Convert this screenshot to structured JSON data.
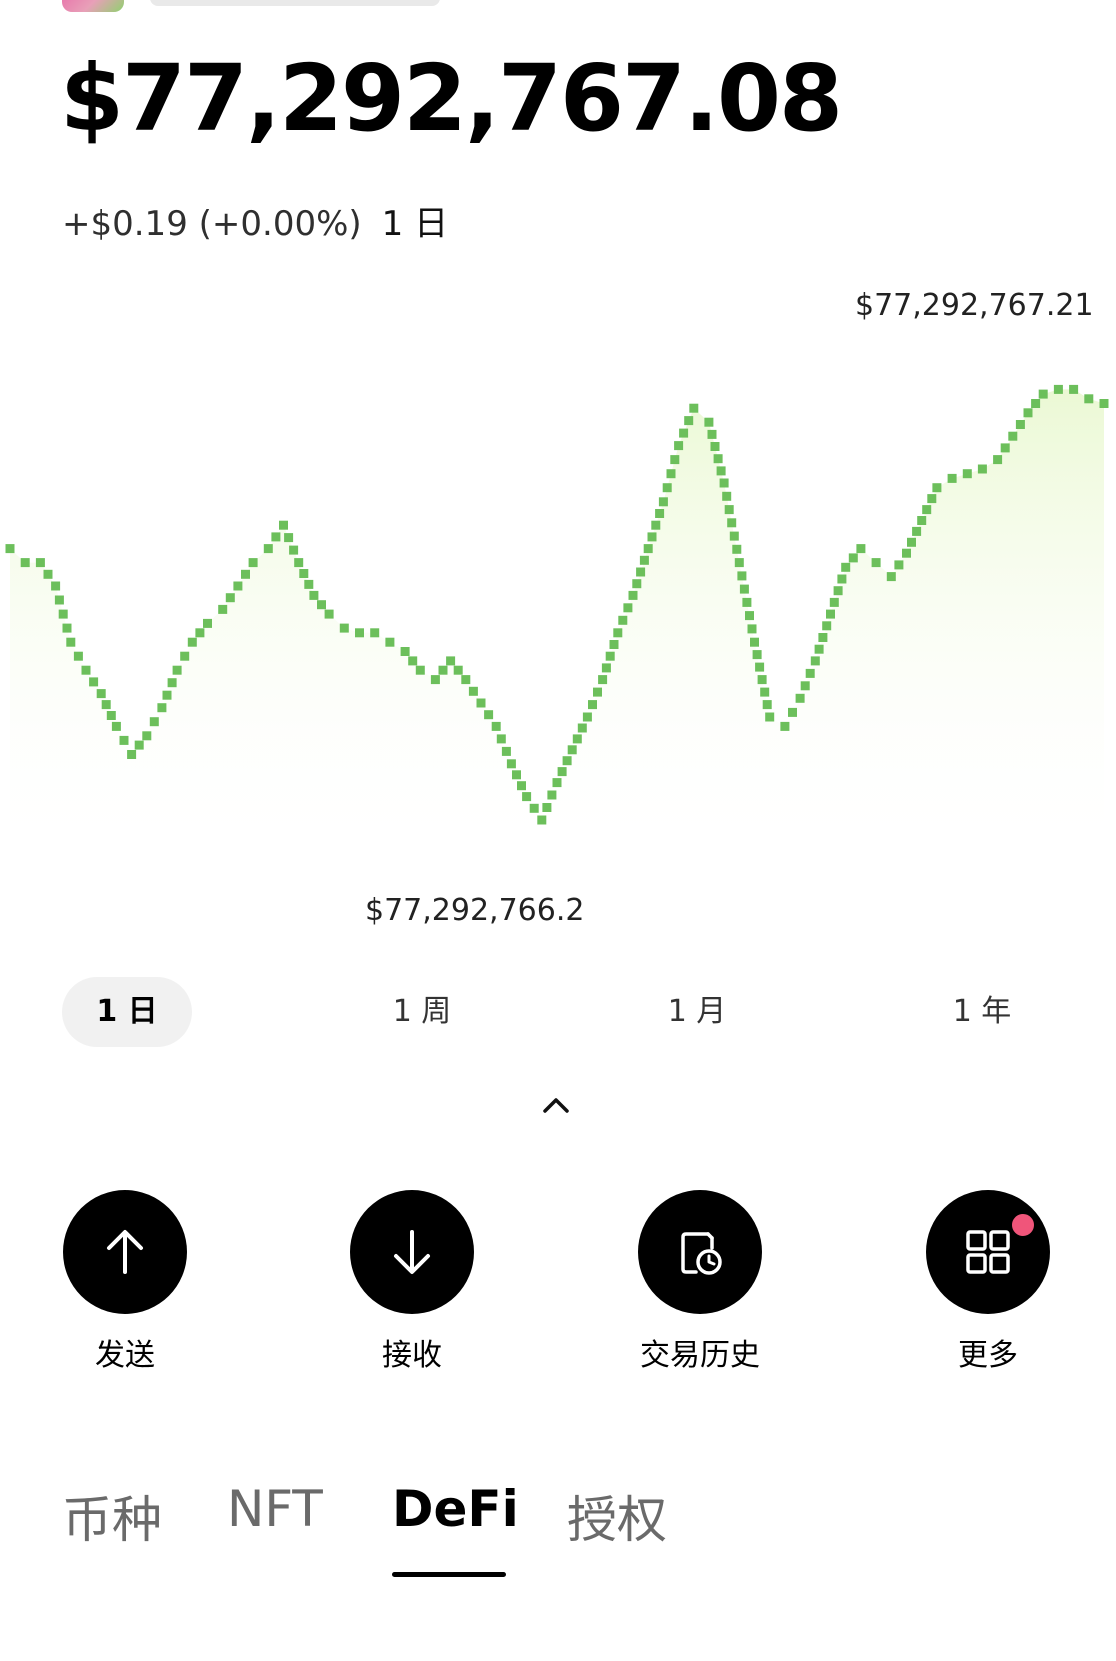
{
  "portfolio": {
    "balance": "$77,292,767.08",
    "change": "+$0.19 (+0.00%)",
    "change_period": "1 日"
  },
  "chart_data": {
    "type": "line",
    "max_label": "$77,292,767.21",
    "min_label": "$77,292,766.2",
    "values": [
      0.58,
      0.55,
      0.55,
      0.5,
      0.38,
      0.32,
      0.27,
      0.2,
      0.14,
      0.18,
      0.24,
      0.32,
      0.38,
      0.42,
      0.45,
      0.5,
      0.55,
      0.58,
      0.63,
      0.55,
      0.48,
      0.44,
      0.41,
      0.4,
      0.4,
      0.38,
      0.36,
      0.32,
      0.3,
      0.34,
      0.3,
      0.25,
      0.2,
      0.12,
      0.05,
      0.0,
      0.08,
      0.15,
      0.22,
      0.3,
      0.4,
      0.48,
      0.58,
      0.68,
      0.8,
      0.88,
      0.85,
      0.72,
      0.55,
      0.38,
      0.22,
      0.2,
      0.26,
      0.34,
      0.44,
      0.54,
      0.58,
      0.55,
      0.52,
      0.57,
      0.64,
      0.71,
      0.73,
      0.74,
      0.75,
      0.77,
      0.82,
      0.87,
      0.91,
      0.92,
      0.92,
      0.9,
      0.89
    ]
  },
  "range_tabs": [
    "1 日",
    "1 周",
    "1 月",
    "1 年"
  ],
  "actions": [
    {
      "label": "发送",
      "icon": "arrow-up-icon"
    },
    {
      "label": "接收",
      "icon": "arrow-down-icon"
    },
    {
      "label": "交易历史",
      "icon": "history-icon"
    },
    {
      "label": "更多",
      "icon": "grid-icon"
    }
  ],
  "asset_tabs": [
    "币种",
    "NFT",
    "DeFi",
    "授权"
  ],
  "colors": {
    "chart_green": "#6cbf5b",
    "chart_fill": "#eaf8d2",
    "notify_dot": "#f0557a"
  }
}
